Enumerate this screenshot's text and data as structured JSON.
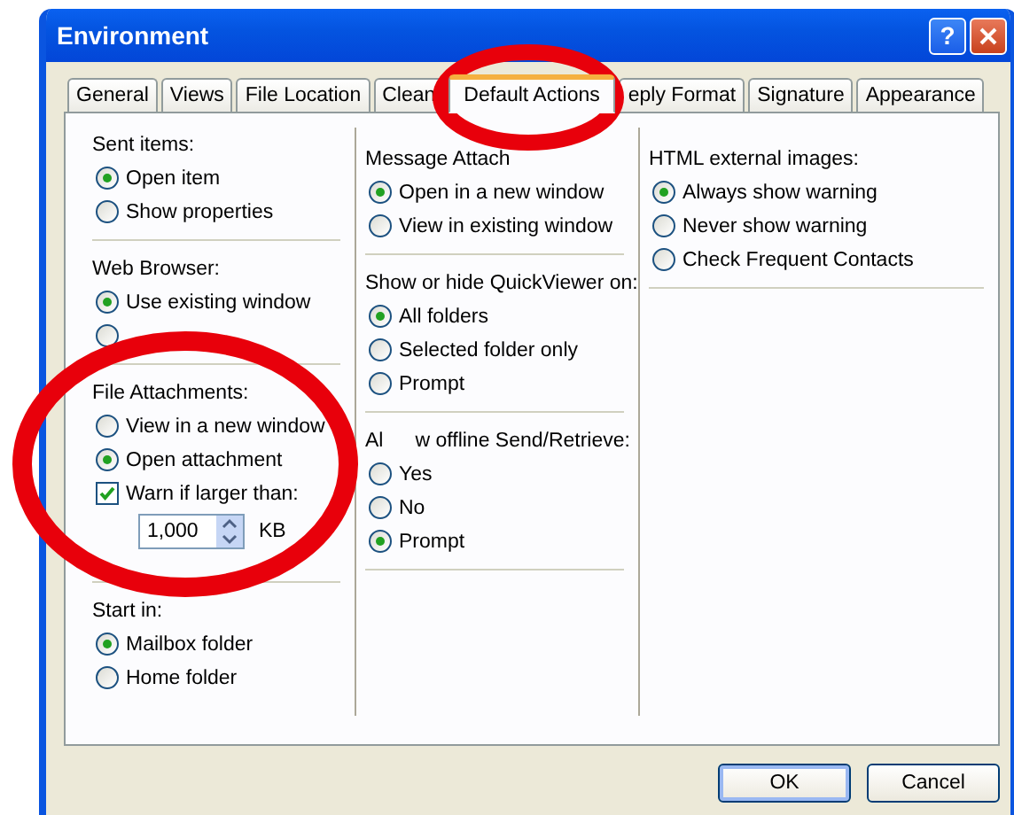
{
  "window": {
    "title": "Environment",
    "help": "?"
  },
  "tabs": [
    {
      "label": "General",
      "selected": false
    },
    {
      "label": "Views",
      "selected": false
    },
    {
      "label": "File Location",
      "selected": false
    },
    {
      "label": "Clean",
      "selected": false
    },
    {
      "label": "Default Actions",
      "selected": true
    },
    {
      "label": "eply Format",
      "selected": false
    },
    {
      "label": "Signature",
      "selected": false
    },
    {
      "label": "Appearance",
      "selected": false
    }
  ],
  "columns": [
    {
      "sections": [
        {
          "heading": [
            "Sent items:"
          ],
          "options": [
            {
              "kind": "radio",
              "label": "Open item",
              "selected": true
            },
            {
              "kind": "radio",
              "label": "Show properties",
              "selected": false
            }
          ]
        },
        {
          "heading": [
            "Web Browser:"
          ],
          "options": [
            {
              "kind": "radio",
              "label": "Use existing window",
              "selected": true
            },
            {
              "kind": "radio",
              "selected": false
            }
          ]
        },
        {
          "heading": [
            "File Attachments:"
          ],
          "options": [
            {
              "kind": "radio",
              "label": "View in a new window",
              "selected": false
            },
            {
              "kind": "radio",
              "label": "Open attachment",
              "selected": true
            },
            {
              "kind": "checkbox",
              "label": "Warn if larger than:",
              "checked": true
            },
            {
              "kind": "spinner",
              "value": "1,000",
              "unit": "KB"
            }
          ]
        },
        {
          "heading": [
            "Start in:"
          ],
          "options": [
            {
              "kind": "radio",
              "label": "Mailbox folder",
              "selected": true
            },
            {
              "kind": "radio",
              "label": "Home folder",
              "selected": false
            }
          ]
        }
      ]
    },
    {
      "sections": [
        {
          "heading": [
            "Message Attach"
          ],
          "options": [
            {
              "kind": "radio",
              "label": "Open in a new window",
              "selected": true
            },
            {
              "kind": "radio",
              "label": "View in existing window",
              "selected": false
            }
          ]
        },
        {
          "heading": [
            "Show or hide QuickViewer on:"
          ],
          "options": [
            {
              "kind": "radio",
              "label": "All folders",
              "selected": true
            },
            {
              "kind": "radio",
              "label": "Selected folder only",
              "selected": false
            },
            {
              "kind": "radio",
              "label": "Prompt",
              "selected": false
            }
          ]
        },
        {
          "heading": [
            "Al",
            "w offline Send/Retrieve:"
          ],
          "options": [
            {
              "kind": "radio",
              "label": "Yes",
              "selected": false
            },
            {
              "kind": "radio",
              "label": "No",
              "selected": false
            },
            {
              "kind": "radio",
              "label": "Prompt",
              "selected": true
            }
          ]
        }
      ]
    },
    {
      "sections": [
        {
          "heading": [
            "HTML external images:"
          ],
          "options": [
            {
              "kind": "radio",
              "label": "Always show warning",
              "selected": true
            },
            {
              "kind": "radio",
              "label": "Never show warning",
              "selected": false
            },
            {
              "kind": "radio",
              "label": "Check Frequent Contacts",
              "selected": false
            }
          ]
        }
      ]
    }
  ],
  "buttons": [
    {
      "label": "OK",
      "default": true
    },
    {
      "label": "Cancel",
      "default": false
    }
  ]
}
